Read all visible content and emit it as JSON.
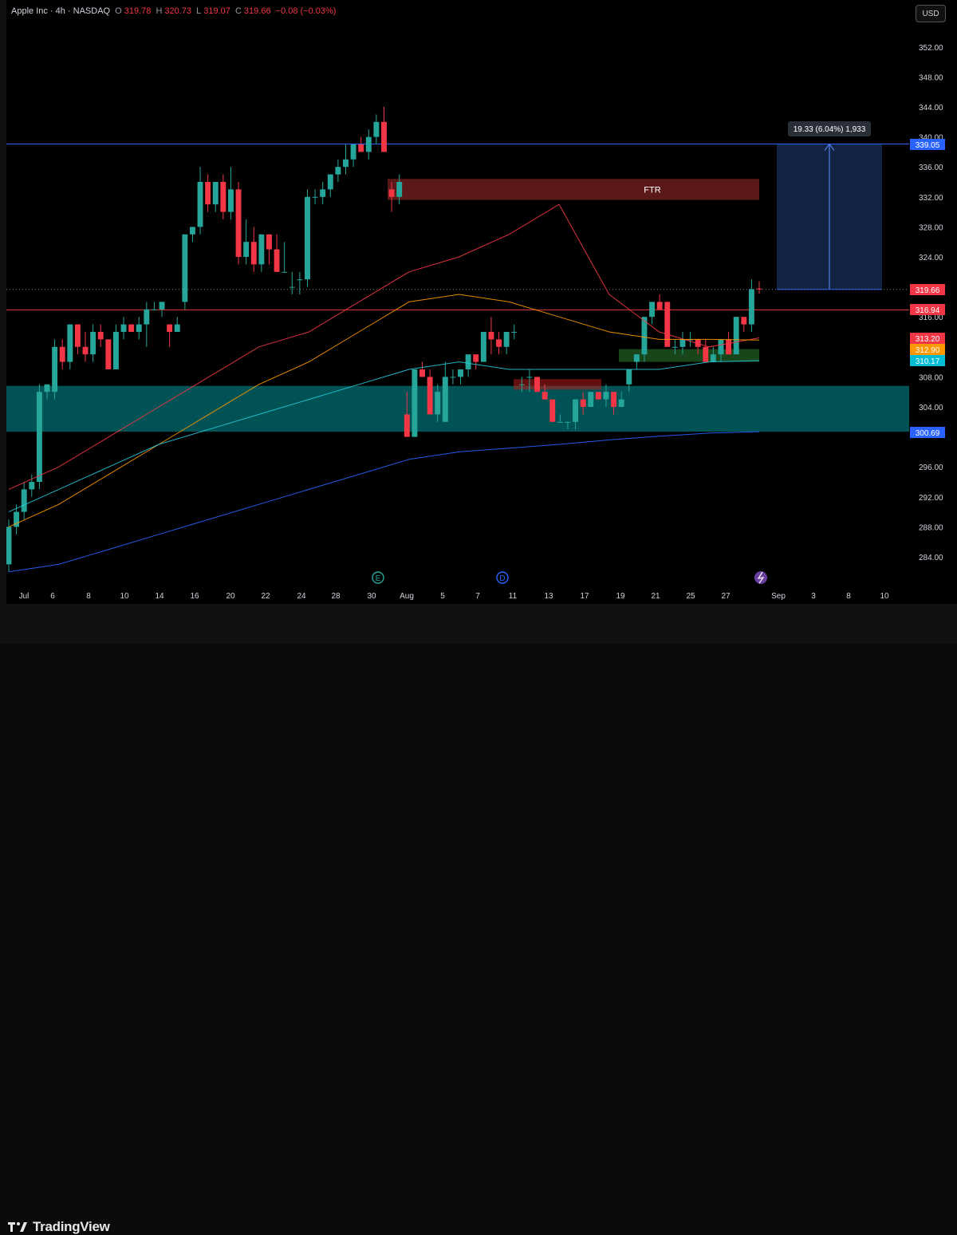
{
  "legend": {
    "symbol": "Apple Inc · 4h · NASDAQ",
    "o_label": "O",
    "o": "319.78",
    "h_label": "H",
    "h": "320.73",
    "l_label": "L",
    "l": "319.07",
    "c_label": "C",
    "c": "319.66",
    "change": "−0.08 (−0.03%)"
  },
  "currency_button": "USD",
  "brand": "TradingView",
  "measure_label": "19.33 (6.04%) 1,933",
  "ftr_label": "FTR",
  "price_ticks": [
    "352.00",
    "348.00",
    "344.00",
    "340.00",
    "336.00",
    "332.00",
    "328.00",
    "324.00",
    "316.00",
    "308.00",
    "304.00",
    "296.00",
    "292.00",
    "288.00",
    "284.00"
  ],
  "price_badges": [
    {
      "text": "339.05",
      "color": "#2962ff"
    },
    {
      "text": "319.66",
      "color": "#f23645"
    },
    {
      "text": "316.94",
      "color": "#f23645"
    },
    {
      "text": "313.20",
      "color": "#f23645"
    },
    {
      "text": "312.90",
      "color": "#ff9800"
    },
    {
      "text": "310.17",
      "color": "#00bcd4"
    },
    {
      "text": "300.69",
      "color": "#2962ff"
    }
  ],
  "time_ticks": [
    "Jul",
    "6",
    "8",
    "10",
    "14",
    "16",
    "20",
    "22",
    "24",
    "28",
    "30",
    "Aug",
    "5",
    "7",
    "11",
    "13",
    "17",
    "19",
    "21",
    "25",
    "27",
    "Sep",
    "3",
    "8",
    "10"
  ],
  "event_markers": [
    "E",
    "D"
  ],
  "colors": {
    "up": "#26a69a",
    "down": "#f23645",
    "blue": "#2962ff",
    "teal_zone": "#00838f"
  },
  "chart_data": {
    "type": "candlestick",
    "title": "Apple Inc · 4h · NASDAQ",
    "ylim": [
      282,
      355
    ],
    "candles": [
      [
        283,
        289,
        282,
        288
      ],
      [
        288,
        291,
        287,
        290
      ],
      [
        290,
        294,
        289,
        293
      ],
      [
        293,
        295,
        292,
        294
      ],
      [
        294,
        307,
        293,
        306
      ],
      [
        306,
        307,
        305,
        307
      ],
      [
        306,
        313,
        305,
        312
      ],
      [
        312,
        313,
        309,
        310
      ],
      [
        310,
        315,
        309,
        315
      ],
      [
        315,
        315,
        311,
        312
      ],
      [
        312,
        314,
        310,
        311
      ],
      [
        311,
        315,
        310,
        314
      ],
      [
        314,
        315,
        312,
        313
      ],
      [
        313,
        313,
        309,
        309
      ],
      [
        309,
        315,
        309,
        314
      ],
      [
        314,
        316,
        313,
        315
      ],
      [
        315,
        315,
        314,
        314
      ],
      [
        314,
        316,
        313,
        315
      ],
      [
        315,
        318,
        312,
        317
      ],
      [
        317,
        318,
        317,
        317
      ],
      [
        317,
        318,
        316,
        318
      ],
      [
        315,
        315,
        312,
        314
      ],
      [
        314,
        316,
        314,
        315
      ],
      [
        318,
        327,
        317,
        327
      ],
      [
        327,
        328,
        326,
        328
      ],
      [
        328,
        336,
        327,
        334
      ],
      [
        334,
        335,
        330,
        331
      ],
      [
        331,
        334,
        330,
        334
      ],
      [
        334,
        335,
        329,
        330
      ],
      [
        330,
        336,
        329,
        333
      ],
      [
        333,
        334,
        323,
        324
      ],
      [
        324,
        329,
        323,
        326
      ],
      [
        326,
        328,
        322,
        323
      ],
      [
        323,
        327,
        322,
        327
      ],
      [
        327,
        327,
        323,
        325
      ],
      [
        325,
        327,
        322,
        322
      ],
      [
        322,
        326,
        322,
        322
      ],
      [
        320,
        322,
        319,
        320
      ],
      [
        321,
        322,
        319,
        321
      ],
      [
        321,
        333,
        320,
        332
      ],
      [
        332,
        333,
        331,
        332
      ],
      [
        332,
        334,
        331,
        333
      ],
      [
        333,
        335,
        332,
        335
      ],
      [
        335,
        337,
        334,
        336
      ],
      [
        336,
        339,
        335,
        337
      ],
      [
        337,
        339,
        336,
        339
      ],
      [
        339,
        340,
        338,
        338
      ],
      [
        338,
        341,
        337,
        340
      ],
      [
        340,
        343,
        339,
        342
      ],
      [
        342,
        344,
        338,
        338
      ],
      [
        333,
        334,
        330,
        332
      ],
      [
        332,
        335,
        331,
        334
      ],
      [
        303,
        306,
        300,
        300
      ],
      [
        300,
        309,
        300,
        309
      ],
      [
        309,
        310,
        308,
        308
      ],
      [
        308,
        309,
        303,
        303
      ],
      [
        303,
        307,
        302,
        306
      ],
      [
        302,
        310,
        302,
        308
      ],
      [
        308,
        309,
        307,
        308
      ],
      [
        308,
        309,
        307,
        309
      ],
      [
        309,
        311,
        308,
        311
      ],
      [
        311,
        311,
        309,
        310
      ],
      [
        310,
        314,
        310,
        314
      ],
      [
        314,
        316,
        311,
        313
      ],
      [
        313,
        314,
        311,
        312
      ],
      [
        312,
        314,
        311,
        314
      ],
      [
        314,
        315,
        313,
        314
      ],
      [
        307,
        308,
        306,
        307
      ],
      [
        308,
        309,
        306,
        308
      ],
      [
        308,
        308,
        306,
        306
      ],
      [
        306,
        307,
        305,
        305
      ],
      [
        305,
        305,
        302,
        302
      ],
      [
        302,
        303,
        302,
        302
      ],
      [
        302,
        302,
        301,
        302
      ],
      [
        302,
        305,
        301,
        305
      ],
      [
        305,
        306,
        303,
        304
      ],
      [
        304,
        306,
        304,
        306
      ],
      [
        306,
        306,
        305,
        305
      ],
      [
        305,
        307,
        304,
        306
      ],
      [
        306,
        306,
        303,
        304
      ],
      [
        304,
        306,
        304,
        305
      ],
      [
        307,
        309,
        306,
        309
      ],
      [
        310,
        311,
        309,
        311
      ],
      [
        311,
        316,
        310,
        316
      ],
      [
        316,
        318,
        315,
        318
      ],
      [
        318,
        319,
        317,
        317
      ],
      [
        318,
        318,
        312,
        312
      ],
      [
        312,
        313,
        311,
        312
      ],
      [
        312,
        314,
        311,
        313
      ],
      [
        313,
        314,
        312,
        313
      ],
      [
        313,
        313,
        311,
        312
      ],
      [
        312,
        313,
        310,
        310
      ],
      [
        310,
        312,
        310,
        311
      ],
      [
        311,
        313,
        310,
        313
      ],
      [
        313,
        314,
        311,
        311
      ],
      [
        311,
        316,
        311,
        316
      ],
      [
        316,
        316,
        314,
        315
      ],
      [
        315,
        321,
        314,
        319.7
      ],
      [
        319.78,
        320.73,
        319.07,
        319.66
      ]
    ],
    "levels": {
      "blue_line": 339.05,
      "red_line": 316.94
    },
    "zones": {
      "teal": [
        300.69,
        306.8
      ],
      "ftr": [
        331.6,
        334.4
      ],
      "green_box": [
        310.0,
        311.7
      ],
      "red_box": [
        306.3,
        307.7
      ]
    },
    "measure": {
      "from": 319.66,
      "to": 339.05
    },
    "moving_averages": [
      {
        "color": "#f23645",
        "values": [
          293,
          296,
          300,
          304,
          308,
          312,
          314,
          318,
          322,
          324,
          327,
          331,
          319,
          314,
          312,
          313.2
        ]
      },
      {
        "color": "#ff9800",
        "values": [
          288,
          291,
          295,
          299,
          303,
          307,
          310,
          314,
          318,
          319,
          318,
          316,
          314,
          313,
          313,
          312.9
        ]
      },
      {
        "color": "#26c6da",
        "values": [
          290,
          293,
          296,
          299,
          301,
          303,
          305,
          307,
          309,
          310,
          309,
          309,
          309,
          309,
          310,
          310.17
        ]
      },
      {
        "color": "#2962ff",
        "values": [
          282,
          283,
          285,
          287,
          289,
          291,
          293,
          295,
          297,
          298,
          298.5,
          299,
          299.6,
          300.1,
          300.5,
          300.69
        ]
      }
    ]
  }
}
